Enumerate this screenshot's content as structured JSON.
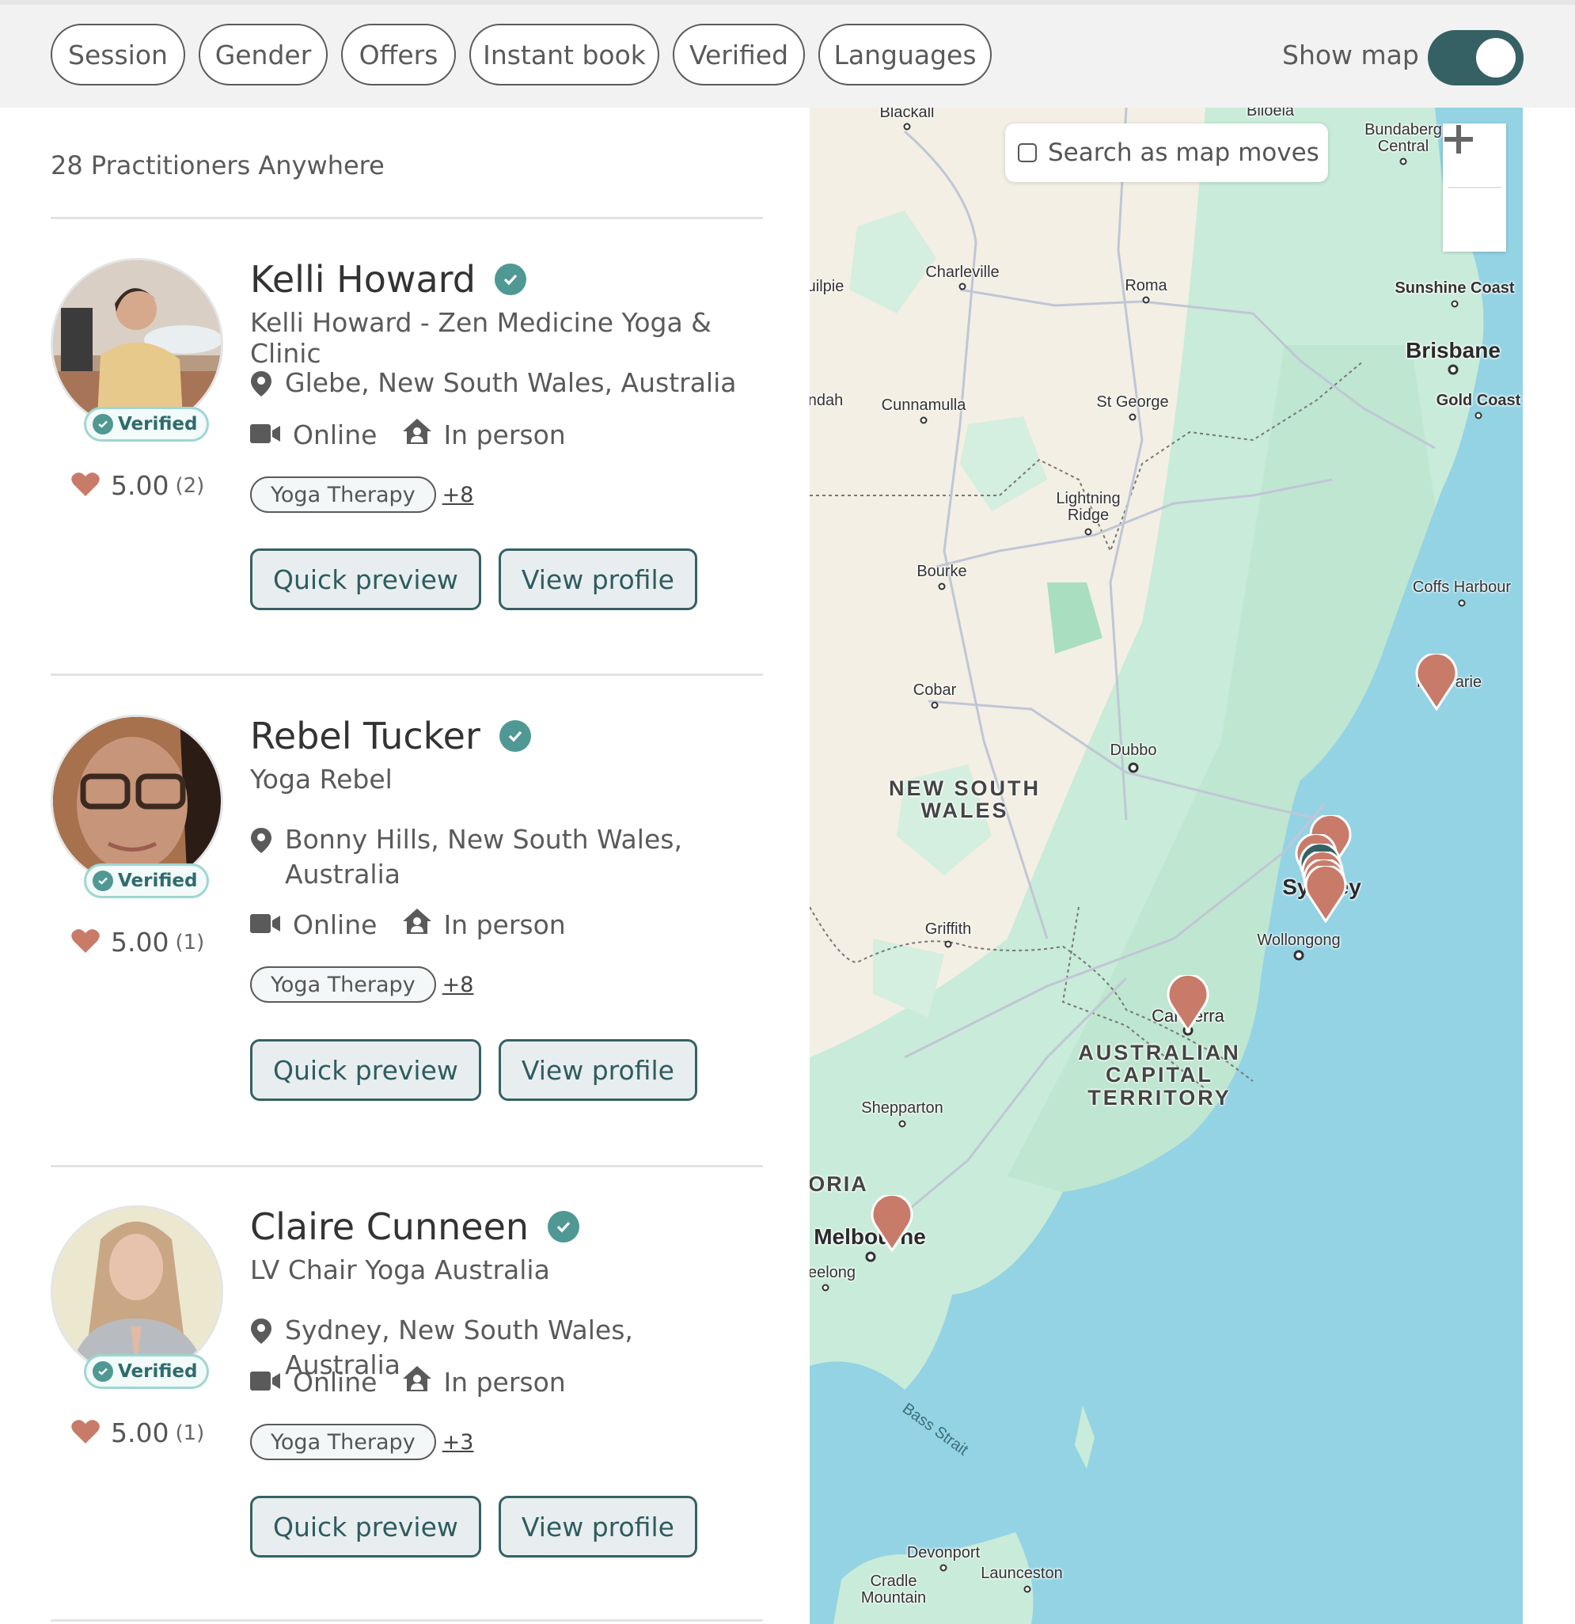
{
  "filters": {
    "chips": [
      {
        "label": "Session"
      },
      {
        "label": "Gender"
      },
      {
        "label": "Offers"
      },
      {
        "label": "Instant book"
      },
      {
        "label": "Verified"
      },
      {
        "label": "Languages"
      }
    ],
    "show_map_label": "Show map",
    "show_map_on": true
  },
  "results": {
    "count_text": "28 Practitioners Anywhere"
  },
  "practitioners": [
    {
      "name": "Kelli Howard",
      "business": "Kelli Howard - Zen Medicine Yoga & Clinic",
      "location": "Glebe, New South Wales, Australia",
      "verified_label": "Verified",
      "modes": [
        "Online",
        "In person"
      ],
      "rating": "5.00",
      "reviews": "(2)",
      "tag": "Yoga Therapy",
      "more_tags": "+8",
      "quick_preview": "Quick preview",
      "view_profile": "View profile"
    },
    {
      "name": "Rebel Tucker",
      "business": "Yoga Rebel",
      "location": "Bonny Hills, New South Wales, Australia",
      "verified_label": "Verified",
      "modes": [
        "Online",
        "In person"
      ],
      "rating": "5.00",
      "reviews": "(1)",
      "tag": "Yoga Therapy",
      "more_tags": "+8",
      "quick_preview": "Quick preview",
      "view_profile": "View profile"
    },
    {
      "name": "Claire Cunneen",
      "business": "LV Chair Yoga Australia",
      "location": "Sydney, New South Wales, Australia",
      "verified_label": "Verified",
      "modes": [
        "Online",
        "In person"
      ],
      "rating": "5.00",
      "reviews": "(1)",
      "tag": "Yoga Therapy",
      "more_tags": "+3",
      "quick_preview": "Quick preview",
      "view_profile": "View profile"
    }
  ],
  "map": {
    "search_as_moves_label": "Search as map moves",
    "search_as_moves_checked": false,
    "zoom_in": "+",
    "zoom_out": "−",
    "places": {
      "blackall": "Blackall",
      "biloela": "Biloela",
      "bundaberg": "Bundaberg\nCentral",
      "quilpie": "uilpie",
      "charleville": "Charleville",
      "roma": "Roma",
      "sunshine_coast": "Sunshine Coast",
      "brisbane": "Brisbane",
      "gold_coast": "Gold Coast",
      "thargomindah": "ndah",
      "cunnamulla": "Cunnamulla",
      "st_george": "St George",
      "lightning_ridge": "Lightning\nRidge",
      "bourke": "Bourke",
      "coffs_harbour": "Coffs Harbour",
      "port_macquarie": "Mac  arie",
      "cobar": "Cobar",
      "dubbo": "Dubbo",
      "nsw": "NEW SOUTH\nWALES",
      "sydney": "Sydney",
      "griffith": "Griffith",
      "wollongong": "Wollongong",
      "canberra": "Canberra",
      "act": "AUSTRALIAN\nCAPITAL\nTERRITORY",
      "shepparton": "Shepparton",
      "victoria": "ORIA",
      "melbourne": "Melbourne",
      "geelong": "eelong",
      "bass_strait": "Bass Strait",
      "devonport": "Devonport",
      "cradle_mountain": "Cradle\nMountain",
      "launceston": "Launceston"
    },
    "pin_color": "#c97b6a",
    "pin_active_color": "#356164"
  },
  "colors": {
    "accent": "#356164",
    "verified": "#4f9894",
    "heart": "#c97b6a",
    "water": "#93d3e4",
    "land_green": "#c9ebd9"
  }
}
